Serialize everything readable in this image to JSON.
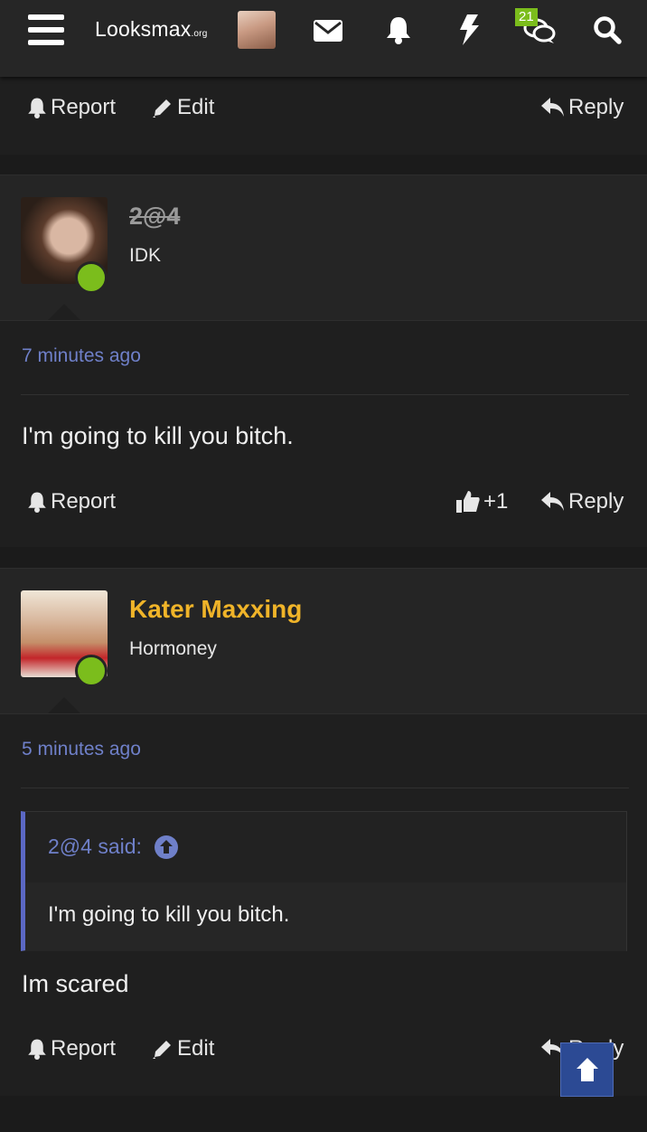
{
  "topbar": {
    "logo_main": "Looksmax",
    "logo_suffix": ".org",
    "conversations_badge": "21",
    "icons": [
      "menu-icon",
      "mail-icon",
      "bell-icon",
      "bolt-icon",
      "chat-icon",
      "search-icon"
    ]
  },
  "top_post_actions": {
    "report": "Report",
    "edit": "Edit",
    "reply": "Reply"
  },
  "posts": [
    {
      "username": "2@4",
      "user_title": "IDK",
      "time": "7 minutes ago",
      "body": "I'm going to kill you bitch.",
      "actions": {
        "report": "Report",
        "like_count": "+1",
        "reply": "Reply"
      }
    },
    {
      "username": "Kater Maxxing",
      "user_title": "Hormoney",
      "time": "5 minutes ago",
      "quote": {
        "author": "2@4 said:",
        "text": "I'm going to kill you bitch."
      },
      "body": "Im scared",
      "actions": {
        "report": "Report",
        "edit": "Edit",
        "reply": "Reply"
      }
    }
  ],
  "colors": {
    "accent_link": "#6f80c9",
    "online": "#7bbd1c",
    "staff_gold": "#f0b429",
    "quote_bar": "#5b68c4"
  }
}
